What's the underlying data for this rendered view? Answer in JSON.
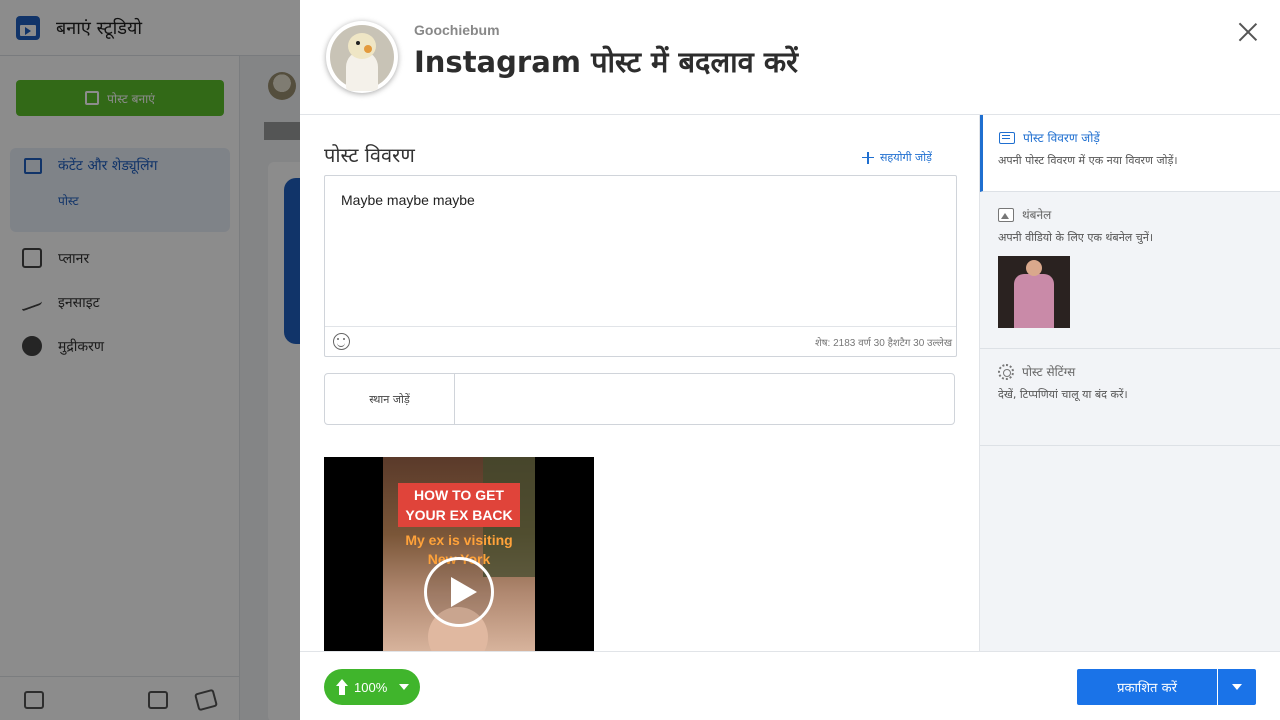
{
  "app": {
    "title": "बनाएं स्टूडियो",
    "create_button": "पोस्ट बनाएं",
    "sidebar": {
      "active_item": "कंटेंट और शेड्यूलिंग",
      "active_sub": "पोस्ट",
      "items": [
        "प्लानर",
        "इनसाइट",
        "मुद्रीकरण"
      ]
    }
  },
  "modal": {
    "account_name": "Goochiebum",
    "title": "Instagram पोस्ट में बदलाव करें",
    "post_section_title": "पोस्ट विवरण",
    "add_collaborator_label": "सहयोगी जोड़ें",
    "post_text": "Maybe maybe maybe",
    "char_counter": "शेष: 2183 वर्ण 30 हैशटैग 30 उल्लेख",
    "location_label": "स्थान जोड़ें",
    "video_caption": {
      "line1": "HOW TO GET",
      "line2": "YOUR EX BACK",
      "line3": "My ex is visiting",
      "line4": "New York"
    },
    "right_panel": {
      "sections": [
        {
          "title": "पोस्ट विवरण जोड़ें",
          "text": "अपनी पोस्ट विवरण में एक नया विवरण जोड़ें।"
        },
        {
          "title": "थंबनेल",
          "text": "अपनी वीडियो के लिए एक थंबनेल चुनें।"
        },
        {
          "title": "पोस्ट सेटिंग्स",
          "text": "देखें, टिप्पणियां चालू या बंद करें।"
        }
      ]
    },
    "footer": {
      "upload_progress": "100%",
      "publish_label": "प्रकाशित करें"
    }
  },
  "colors": {
    "accent": "#1a73e8",
    "upload_green": "#40b52c",
    "create_green": "#5cbf2a"
  },
  "icons": {
    "close": "close-icon",
    "emoji": "emoji-icon",
    "plus": "plus-icon",
    "play": "play-icon",
    "upload": "upload-arrow-icon",
    "dropdown": "chevron-down-icon"
  }
}
